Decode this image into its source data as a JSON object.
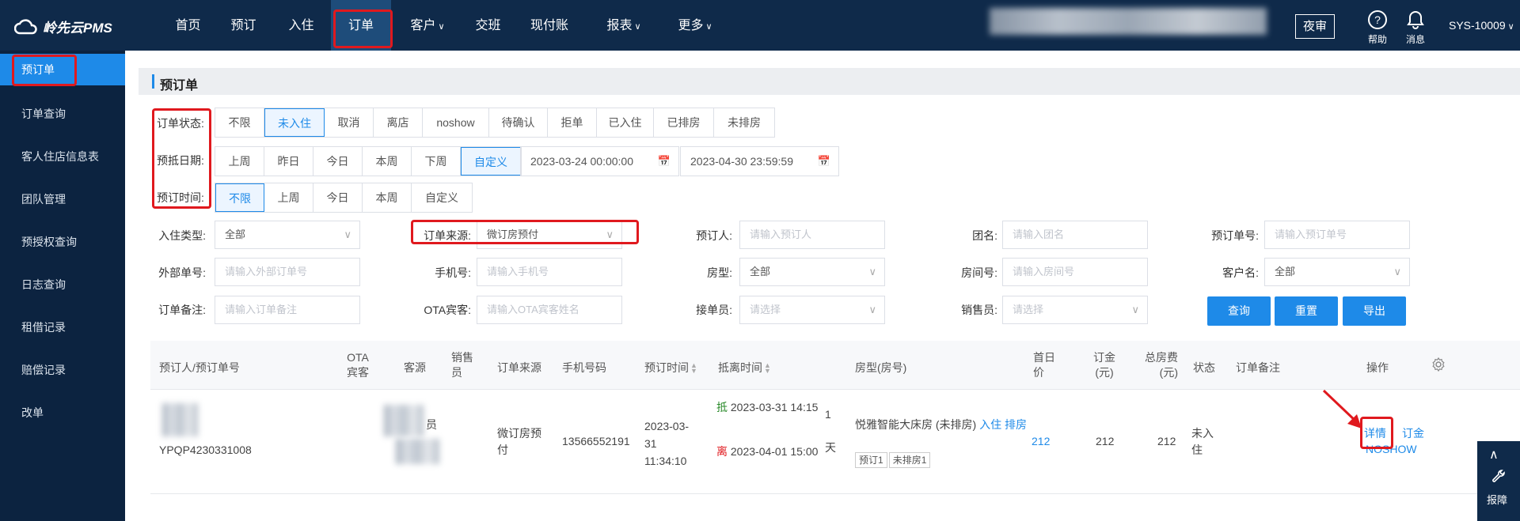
{
  "app": {
    "brand": "岭先云PMS"
  },
  "nav": [
    {
      "label": "首页",
      "dropdown": false
    },
    {
      "label": "预订",
      "dropdown": false
    },
    {
      "label": "入住",
      "dropdown": false
    },
    {
      "label": "订单",
      "dropdown": false,
      "active": true
    },
    {
      "label": "客户",
      "dropdown": true
    },
    {
      "label": "交班",
      "dropdown": false
    },
    {
      "label": "现付账",
      "dropdown": false
    },
    {
      "label": "报表",
      "dropdown": true
    },
    {
      "label": "更多",
      "dropdown": true
    }
  ],
  "topright": {
    "night_audit": "夜审",
    "help": "帮助",
    "message": "消息",
    "user": "SYS-10009"
  },
  "sidebar": {
    "items": [
      {
        "label": "预订单",
        "active": true
      },
      {
        "label": "订单查询"
      },
      {
        "label": "客人住店信息表"
      },
      {
        "label": "团队管理"
      },
      {
        "label": "预授权查询"
      },
      {
        "label": "日志查询"
      },
      {
        "label": "租借记录"
      },
      {
        "label": "赔偿记录"
      },
      {
        "label": "改单"
      }
    ]
  },
  "page": {
    "title": "预订单"
  },
  "filters": {
    "order_status": {
      "label": "订单状态:",
      "options": [
        "不限",
        "未入住",
        "取消",
        "离店",
        "noshow",
        "待确认",
        "拒单",
        "已入住",
        "已排房",
        "未排房"
      ],
      "selected": "未入住"
    },
    "arrival_date": {
      "label": "预抵日期:",
      "options": [
        "上周",
        "昨日",
        "今日",
        "本周",
        "下周",
        "自定义"
      ],
      "selected": "自定义",
      "start": "2023-03-24 00:00:00",
      "end": "2023-04-30 23:59:59"
    },
    "booking_time": {
      "label": "预订时间:",
      "options": [
        "不限",
        "上周",
        "今日",
        "本周",
        "自定义"
      ],
      "selected": "不限"
    }
  },
  "form": {
    "checkin_type": {
      "label": "入住类型:",
      "value": "全部"
    },
    "order_source": {
      "label": "订单来源:",
      "value": "微订房预付"
    },
    "booker": {
      "label": "预订人:",
      "placeholder": "请输入预订人"
    },
    "group_name": {
      "label": "团名:",
      "placeholder": "请输入团名"
    },
    "booking_no": {
      "label": "预订单号:",
      "placeholder": "请输入预订单号"
    },
    "external_no": {
      "label": "外部单号:",
      "placeholder": "请输入外部订单号"
    },
    "phone": {
      "label": "手机号:",
      "placeholder": "请输入手机号"
    },
    "room_type": {
      "label": "房型:",
      "value": "全部"
    },
    "room_no": {
      "label": "房间号:",
      "placeholder": "请输入房间号"
    },
    "customer_name": {
      "label": "客户名:",
      "value": "全部"
    },
    "order_remark": {
      "label": "订单备注:",
      "placeholder": "请输入订单备注"
    },
    "ota_guest": {
      "label": "OTA宾客:",
      "placeholder": "请输入OTA宾客姓名"
    },
    "receiver": {
      "label": "接单员:",
      "placeholder": "请选择"
    },
    "salesperson": {
      "label": "销售员:",
      "placeholder": "请选择"
    },
    "buttons": {
      "query": "查询",
      "reset": "重置",
      "export": "导出"
    }
  },
  "table": {
    "headers": {
      "booker": "预订人/预订单号",
      "ota_guest": "OTA宾客",
      "guest_source": "客源",
      "salesperson": "销售员",
      "order_source": "订单来源",
      "phone": "手机号码",
      "booking_time": "预订时间",
      "arrive_leave": "抵离时间",
      "room_type": "房型(房号)",
      "first_day_price": "首日价",
      "deposit": "订金(元)",
      "total_room_fee": "总房费(元)",
      "status": "状态",
      "remark": "订单备注",
      "actions": "操作"
    },
    "rows": [
      {
        "booking_no": "YPQP4230331008",
        "order_source": "微订房预付",
        "phone": "13566552191",
        "booking_time": "2023-03-31 11:34:10",
        "arrive_label": "抵",
        "arrive": "2023-03-31 14:15",
        "leave_label": "离",
        "leave": "2023-04-01 15:00",
        "nights_num": "1",
        "nights_unit": "天",
        "room": "悦雅智能大床房 (未排房)",
        "room_actions": [
          "入住",
          "排房"
        ],
        "tags": [
          "预订1",
          "未排房1"
        ],
        "first_day_price": "212",
        "deposit": "212",
        "total_room_fee": "212",
        "status": "未入住",
        "actions": [
          "详情",
          "订金",
          "NOSHOW"
        ],
        "salesperson_partial": "员"
      }
    ]
  },
  "float": {
    "report_label": "报障"
  }
}
